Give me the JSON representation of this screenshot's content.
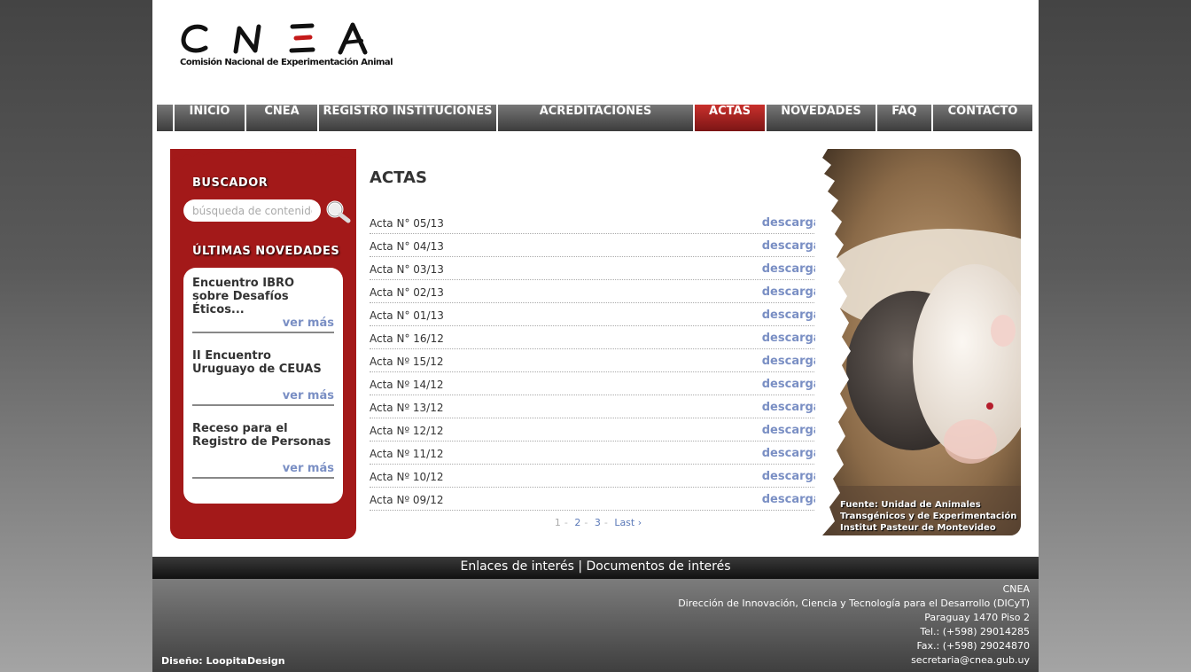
{
  "header": {
    "logo_mark": "CNEA",
    "logo_tagline": "Comisión Nacional de Experimentación Animal"
  },
  "nav": {
    "items": [
      {
        "label": "INICIO"
      },
      {
        "label": "CNEA"
      },
      {
        "label": "REGISTRO INSTITUCIONES"
      },
      {
        "label": "ACREDITACIONES"
      },
      {
        "label": "ACTAS",
        "active": true
      },
      {
        "label": "NOVEDADES"
      },
      {
        "label": "FAQ"
      },
      {
        "label": "CONTACTO"
      }
    ]
  },
  "sidebar": {
    "search_heading": "BUSCADOR",
    "search_placeholder": "búsqueda de contenido",
    "news_heading": "ÚLTIMAS NOVEDADES",
    "news": [
      {
        "title": "Encuentro IBRO sobre Desafíos Éticos...",
        "more": "ver más"
      },
      {
        "title": "II Encuentro Uruguayo de CEUAS",
        "more": "ver más"
      },
      {
        "title": "Receso para el Registro de Personas",
        "more": "ver más"
      }
    ]
  },
  "main": {
    "title": "ACTAS",
    "download_label": "descargar",
    "actas": [
      "Acta N° 05/13",
      "Acta N° 04/13",
      "Acta N° 03/13",
      "Acta N° 02/13",
      "Acta N° 01/13",
      "Acta N° 16/12",
      "Acta Nº 15/12",
      "Acta Nº 14/12",
      "Acta Nº 13/12",
      "Acta Nº 12/12",
      "Acta Nº 11/12",
      "Acta Nº 10/12",
      "Acta Nº 09/12"
    ],
    "pager": {
      "current": "1",
      "pages": [
        "2",
        "3"
      ],
      "last": "Last ›",
      "separator": "-"
    }
  },
  "photo": {
    "credit_lines": [
      "Fuente: Unidad de Animales",
      "Transgénicos y de Experimentación",
      "Institut Pasteur de Montevideo"
    ]
  },
  "footer": {
    "links": [
      "Enlaces de interés",
      "Documentos de interés"
    ],
    "link_separator": "|",
    "contact_lines": [
      "CNEA",
      "Dirección de Innovación, Ciencia y Tecnología para el Desarrollo (DICyT)",
      "Paraguay 1470 Piso 2",
      "Tel.: (+598) 29014285",
      "Fax.: (+598) 29024870",
      "secretaria@cnea.gub.uy"
    ],
    "credit": "Diseño: LoopitaDesign"
  },
  "colors": {
    "accent_red": "#a31919",
    "link_blue": "#7a8fc4",
    "nav_gray": "#555555"
  },
  "icons": [
    "search-icon"
  ]
}
